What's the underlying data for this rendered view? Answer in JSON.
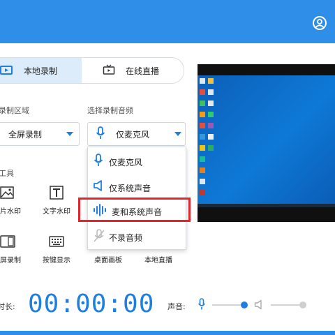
{
  "tabs": {
    "local": "本地录制",
    "live": "在线直播"
  },
  "record_area": {
    "label": "录制区域",
    "value": "全屏录制"
  },
  "audio": {
    "label": "选择录制音频",
    "value": "仅麦克风"
  },
  "dropdown": {
    "options": [
      "仅麦克风",
      "仅系统声音",
      "麦和系统声音",
      "不录音频"
    ],
    "highlighted": "麦和系统声音"
  },
  "tools": {
    "label": "工具",
    "items": [
      "片水印",
      "文字水印",
      "屏录制",
      "按键显示",
      "桌面画板",
      "本地直播"
    ]
  },
  "bottom": {
    "duration_label": "时长:",
    "time": "00:00:00",
    "sound_label": "声音:",
    "mic_level": 1.0,
    "system_level": 1.0
  },
  "colors": {
    "brand": "#2f8ee7",
    "accent": "#1e7fe0",
    "highlight": "#e0262a"
  },
  "icons": [
    "user-icon",
    "video-icon",
    "tv-icon",
    "mic-icon",
    "speaker-icon",
    "waveform-icon",
    "no-audio-icon",
    "image-icon",
    "text-icon",
    "screen-icon",
    "keyboard-icon"
  ]
}
